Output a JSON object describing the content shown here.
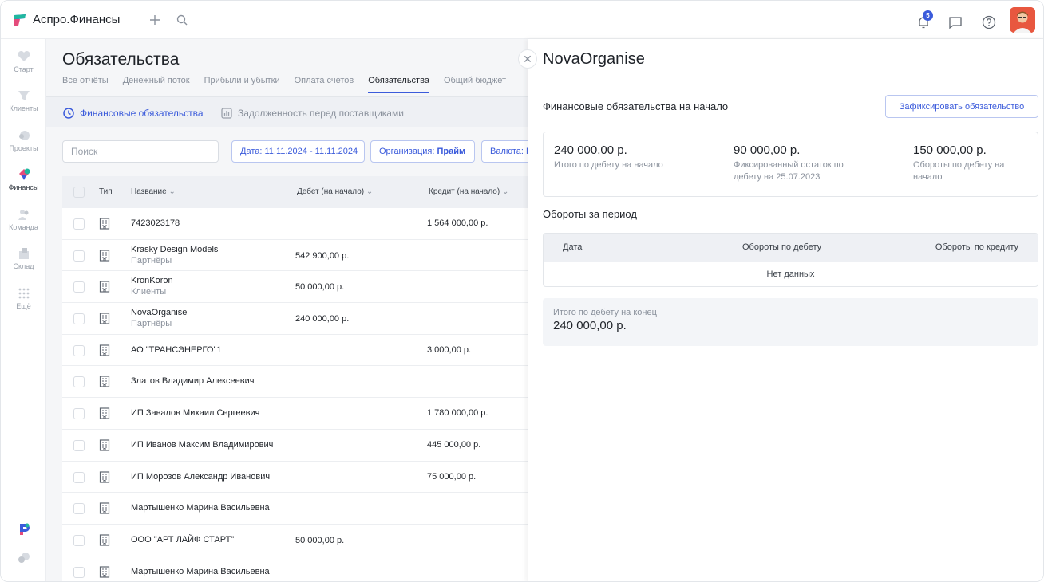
{
  "app": {
    "name": "Аспро.Финансы",
    "notifications_count": "5"
  },
  "sidebar": {
    "items": [
      {
        "label": "Старт",
        "icon": "heart-icon"
      },
      {
        "label": "Клиенты",
        "icon": "funnel-icon"
      },
      {
        "label": "Проекты",
        "icon": "projects-icon"
      },
      {
        "label": "Финансы",
        "icon": "finance-icon"
      },
      {
        "label": "Команда",
        "icon": "team-icon"
      },
      {
        "label": "Склад",
        "icon": "warehouse-icon"
      },
      {
        "label": "Ещё",
        "icon": "more-icon"
      }
    ]
  },
  "page": {
    "title": "Обязательства",
    "tabs": [
      "Все отчёты",
      "Денежный поток",
      "Прибыли и убытки",
      "Оплата счетов",
      "Обязательства",
      "Общий бюджет"
    ],
    "active_tab": "Обязательства",
    "subnav": {
      "financial": "Финансовые обязательства",
      "suppliers": "Задолженность перед поставщиками"
    },
    "filters": {
      "search_placeholder": "Поиск",
      "date": "Дата: 11.11.2024 - 11.11.2024",
      "org_label": "Организация: ",
      "org_value": "Прайм",
      "currency": "Валюта: Р"
    }
  },
  "table": {
    "columns": {
      "type": "Тип",
      "name": "Название",
      "debit": "Дебет (на начало)",
      "credit": "Кредит (на начало)"
    },
    "rows": [
      {
        "name": "7423023178",
        "sub": "",
        "debit": "",
        "credit": "1 564 000,00 р."
      },
      {
        "name": "Krasky Design Models",
        "sub": "Партнёры",
        "debit": "542 900,00 р.",
        "credit": ""
      },
      {
        "name": "KronKoron",
        "sub": "Клиенты",
        "debit": "50 000,00 р.",
        "credit": ""
      },
      {
        "name": "NovaOrganise",
        "sub": "Партнёры",
        "debit": "240 000,00 р.",
        "credit": ""
      },
      {
        "name": "АО \"ТРАНСЭНЕРГО\"1",
        "sub": "",
        "debit": "",
        "credit": "3 000,00 р."
      },
      {
        "name": "Златов Владимир Алексеевич",
        "sub": "",
        "debit": "",
        "credit": ""
      },
      {
        "name": "ИП Завалов Михаил Сергеевич",
        "sub": "",
        "debit": "",
        "credit": "1 780 000,00 р."
      },
      {
        "name": "ИП Иванов Максим Владимирович",
        "sub": "",
        "debit": "",
        "credit": "445 000,00 р."
      },
      {
        "name": "ИП Морозов Александр Иванович",
        "sub": "",
        "debit": "",
        "credit": "75 000,00 р."
      },
      {
        "name": "Мартышенко Марина Васильевна",
        "sub": "",
        "debit": "",
        "credit": ""
      },
      {
        "name": "ООО \"АРТ ЛАЙФ СТАРТ\"",
        "sub": "",
        "debit": "50 000,00 р.",
        "credit": ""
      },
      {
        "name": "Мартышенко Марина Васильевна",
        "sub": "",
        "debit": "",
        "credit": ""
      }
    ]
  },
  "panel": {
    "title": "NovaOrganise",
    "section1": "Финансовые обязательства на начало",
    "fix_button": "Зафиксировать обязательство",
    "cards": [
      {
        "value": "240 000,00 р.",
        "label": "Итого по дебету на начало"
      },
      {
        "value": "90 000,00 р.",
        "label": "Фиксированный остаток по дебету на 25.07.2023"
      },
      {
        "value": "150 000,00 р.",
        "label": "Обороты по дебету на начало"
      }
    ],
    "section2": "Обороты за период",
    "turnover_columns": {
      "date": "Дата",
      "debit": "Обороты по дебету",
      "credit": "Обороты по кредиту"
    },
    "no_data": "Нет данных",
    "total": {
      "label": "Итого по дебету на конец",
      "value": "240 000,00 р."
    }
  },
  "colors": {
    "accent": "#3b5bdb",
    "bg": "#f5f6f8"
  }
}
